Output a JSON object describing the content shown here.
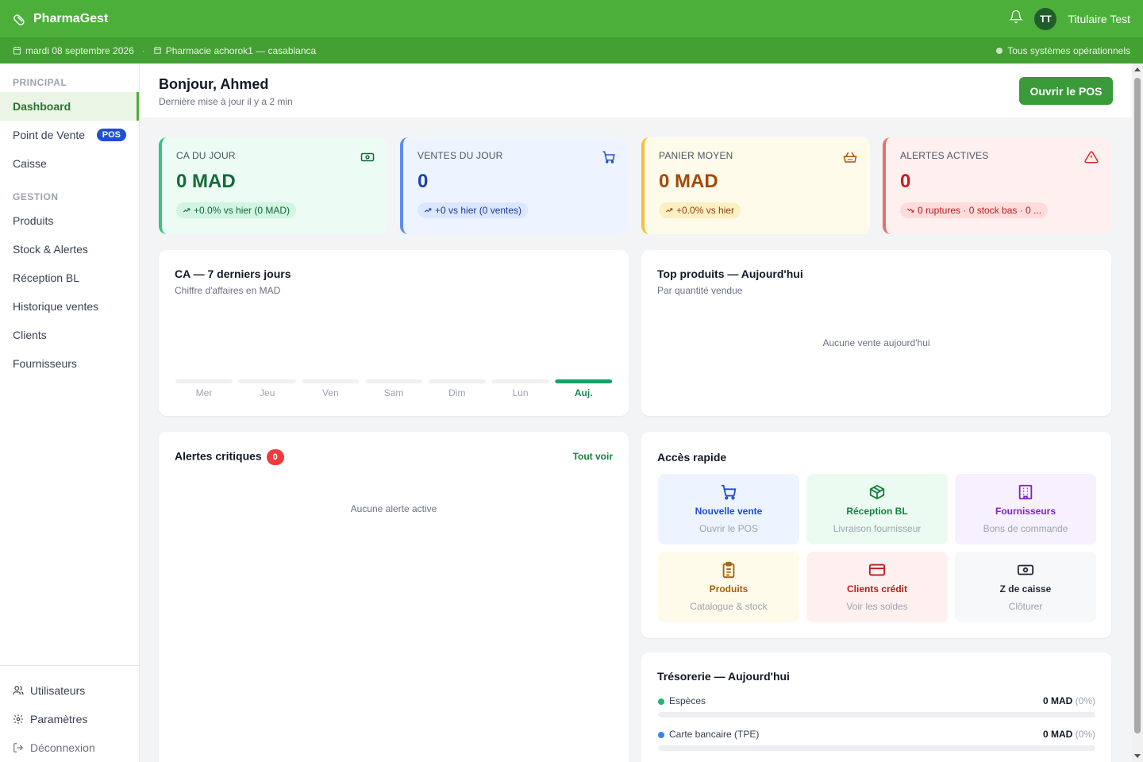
{
  "app": {
    "name": "PharmaGest",
    "user_initials": "TT",
    "user_name": "Titulaire Test"
  },
  "subbar": {
    "date": "mardi 08 septembre 2026",
    "separator": "·",
    "pharmacy": "Pharmacie achorok1 — casablanca",
    "status": "Tous systèmes opérationnels"
  },
  "sidebar": {
    "section_principal": "PRINCIPAL",
    "section_gestion": "GESTION",
    "principal": [
      {
        "label": "Dashboard"
      },
      {
        "label": "Point de Vente",
        "badge": "POS"
      },
      {
        "label": "Caisse"
      }
    ],
    "gestion": [
      {
        "label": "Produits"
      },
      {
        "label": "Stock & Alertes"
      },
      {
        "label": "Réception BL"
      },
      {
        "label": "Historique ventes"
      },
      {
        "label": "Clients"
      },
      {
        "label": "Fournisseurs"
      }
    ],
    "bottom": [
      {
        "label": "Utilisateurs"
      },
      {
        "label": "Paramètres"
      },
      {
        "label": "Déconnexion"
      }
    ]
  },
  "header": {
    "greeting": "Bonjour, Ahmed",
    "last_update": "Dernière mise à jour il y a 2 min",
    "pos_button": "Ouvrir le POS"
  },
  "kpis": [
    {
      "label": "CA DU JOUR",
      "value": "0 MAD",
      "badge": "+0.0% vs hier (0 MAD)",
      "icon": "cash-icon",
      "color": "#34c77b"
    },
    {
      "label": "VENTES DU JOUR",
      "value": "0",
      "badge": "+0 vs hier (0 ventes)",
      "icon": "cart-icon",
      "color": "#5b8def"
    },
    {
      "label": "PANIER MOYEN",
      "value": "0 MAD",
      "badge": "+0.0% vs hier",
      "icon": "basket-icon",
      "color": "#f2c230"
    },
    {
      "label": "ALERTES ACTIVES",
      "value": "0",
      "badge": "0 ruptures · 0 stock bas · 0 ...",
      "icon": "warning-icon",
      "color": "#ef6b6b"
    }
  ],
  "ca_chart": {
    "title": "CA — 7 derniers jours",
    "subtitle": "Chiffre d'affaires en MAD"
  },
  "chart_data": {
    "type": "bar",
    "categories": [
      "Mer",
      "Jeu",
      "Ven",
      "Sam",
      "Dim",
      "Lun",
      "Auj."
    ],
    "values": [
      0,
      0,
      0,
      0,
      0,
      0,
      0
    ],
    "highlight_index": 6,
    "title": "CA — 7 derniers jours",
    "subtitle": "Chiffre d'affaires en MAD",
    "ylabel": ""
  },
  "top_products": {
    "title": "Top produits — Aujourd'hui",
    "subtitle": "Par quantité vendue",
    "empty": "Aucune vente aujourd'hui"
  },
  "alerts": {
    "title": "Alertes critiques",
    "count": "0",
    "link": "Tout voir",
    "empty": "Aucune alerte active"
  },
  "quick_access": {
    "title": "Accès rapide",
    "tiles": [
      {
        "title": "Nouvelle vente",
        "sub": "Ouvrir le POS",
        "icon": "cart-icon"
      },
      {
        "title": "Réception BL",
        "sub": "Livraison fournisseur",
        "icon": "package-icon"
      },
      {
        "title": "Fournisseurs",
        "sub": "Bons de commande",
        "icon": "building-icon"
      },
      {
        "title": "Produits",
        "sub": "Catalogue & stock",
        "icon": "clipboard-icon"
      },
      {
        "title": "Clients crédit",
        "sub": "Voir les soldes",
        "icon": "credit-card-icon"
      },
      {
        "title": "Z de caisse",
        "sub": "Clôturer",
        "icon": "cash-icon"
      }
    ]
  },
  "treasury": {
    "title": "Trésorerie — Aujourd'hui",
    "rows": [
      {
        "label": "Espèces",
        "amount": "0 MAD",
        "pct": "(0%)",
        "color": "#22b573",
        "share": 0
      },
      {
        "label": "Carte bancaire (TPE)",
        "amount": "0 MAD",
        "pct": "(0%)",
        "color": "#3b82f6",
        "share": 0
      }
    ]
  },
  "colors": {
    "brand": "#4caf3a",
    "brand_dark": "#43a033",
    "accent_today": "#12a46a"
  }
}
